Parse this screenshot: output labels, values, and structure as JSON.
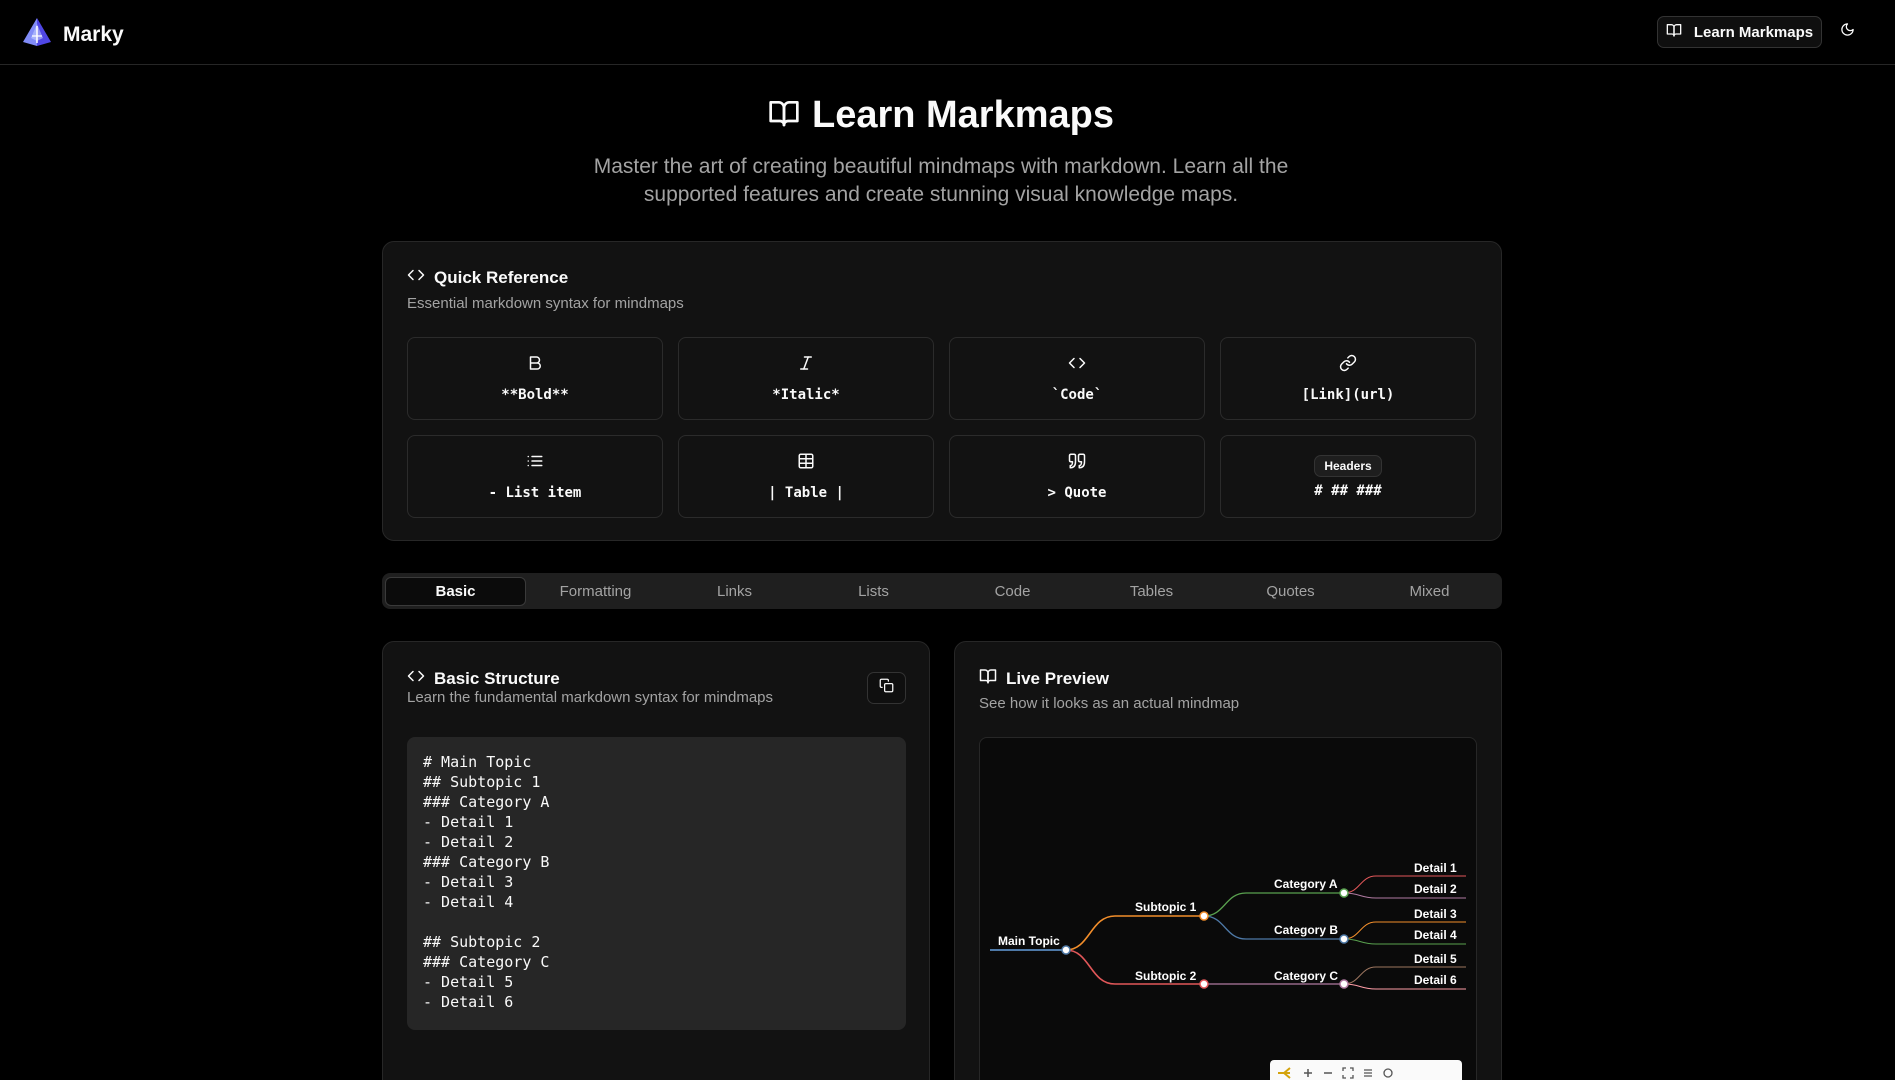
{
  "header": {
    "brand": "Marky",
    "learn_button": "Learn Markmaps"
  },
  "hero": {
    "title": "Learn Markmaps",
    "subtitle": "Master the art of creating beautiful mindmaps with markdown. Learn all the supported features and create stunning visual knowledge maps."
  },
  "quick_reference": {
    "title": "Quick Reference",
    "description": "Essential markdown syntax for mindmaps",
    "items": [
      {
        "icon": "bold-icon",
        "syntax": "**Bold**"
      },
      {
        "icon": "italic-icon",
        "syntax": "*Italic*"
      },
      {
        "icon": "code-icon",
        "syntax": "`Code`"
      },
      {
        "icon": "link-icon",
        "syntax": "[Link](url)"
      },
      {
        "icon": "list-icon",
        "syntax": "- List item"
      },
      {
        "icon": "table-icon",
        "syntax": "| Table |"
      },
      {
        "icon": "quote-icon",
        "syntax": "> Quote"
      },
      {
        "badge": "Headers",
        "syntax": "# ## ###"
      }
    ]
  },
  "tabs": [
    "Basic",
    "Formatting",
    "Links",
    "Lists",
    "Code",
    "Tables",
    "Quotes",
    "Mixed"
  ],
  "active_tab": "Basic",
  "basic": {
    "title": "Basic Structure",
    "description": "Learn the fundamental markdown syntax for mindmaps",
    "code": "# Main Topic\n## Subtopic 1\n### Category A\n- Detail 1\n- Detail 2\n### Category B\n- Detail 3\n- Detail 4\n\n## Subtopic 2\n### Category C\n- Detail 5\n- Detail 6"
  },
  "preview": {
    "title": "Live Preview",
    "description": "See how it looks as an actual mindmap",
    "mindmap": {
      "root": "Main Topic",
      "subtopic1": "Subtopic 1",
      "subtopic2": "Subtopic 2",
      "catA": "Category A",
      "catB": "Category B",
      "catC": "Category C",
      "d1": "Detail 1",
      "d2": "Detail 2",
      "d3": "Detail 3",
      "d4": "Detail 4",
      "d5": "Detail 5",
      "d6": "Detail 6"
    }
  },
  "colors": {
    "background": "#000000",
    "card": "#121212",
    "border": "#272727",
    "muted_text": "#a3a3a3",
    "branch_subtopic1": "#f28e2b",
    "branch_subtopic2": "#e15759",
    "branch_catA": "#59a14f",
    "branch_catB": "#4e79a7",
    "branch_catC": "#b07aa1"
  }
}
